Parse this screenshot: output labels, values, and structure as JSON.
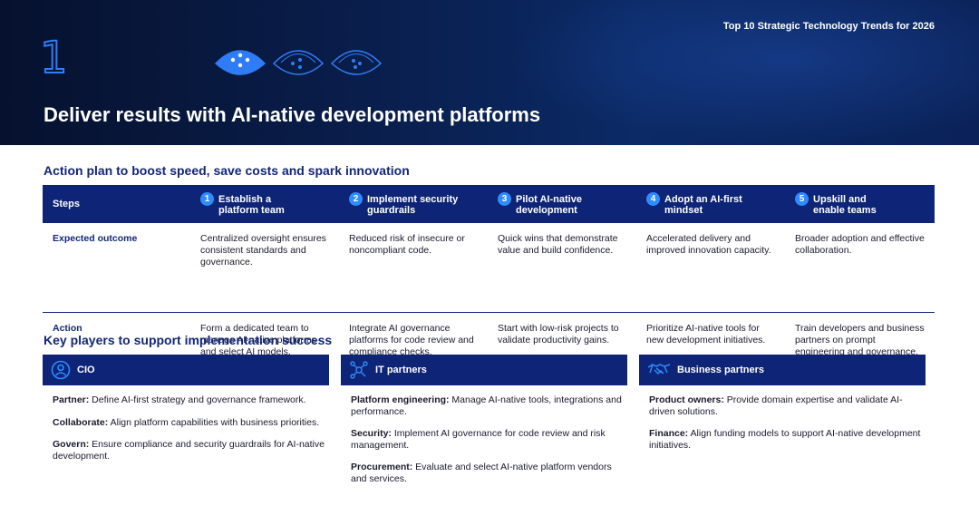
{
  "header": {
    "doc_title": "Top 10 Strategic Technology Trends for 2026",
    "trend_number": "1",
    "title": "Deliver results with AI-native development platforms",
    "icons": [
      "trend-fan-icon-active",
      "trend-fan-icon",
      "trend-fan-icon"
    ]
  },
  "action_plan": {
    "heading": "Action plan to boost speed, save costs and spark innovation",
    "steps_label": "Steps",
    "steps": [
      {
        "num": "1",
        "label": "Establish a\nplatform team"
      },
      {
        "num": "2",
        "label": "Implement security\nguardrails"
      },
      {
        "num": "3",
        "label": "Pilot AI-native\ndevelopment"
      },
      {
        "num": "4",
        "label": "Adopt an AI-first\nmindset"
      },
      {
        "num": "5",
        "label": "Upskill and\nenable teams"
      }
    ],
    "rows": [
      {
        "label": "Expected outcome",
        "cells": [
          "Centralized oversight ensures consistent standards and governance.",
          "Reduced risk of insecure or noncompliant code.",
          "Quick wins that demonstrate value and build confidence.",
          "Accelerated delivery and improved innovation capacity.",
          "Broader adoption and effective collaboration."
        ]
      },
      {
        "label": "Action",
        "cells": [
          "Form a dedicated team to manage AI-native platforms and select AI models.",
          "Integrate AI governance platforms for code review and compliance checks.",
          "Start with low-risk projects to validate productivity gains.",
          "Prioritize AI-native tools for new development initiatives.",
          "Train developers and business partners on prompt engineering and governance."
        ]
      }
    ]
  },
  "key_players": {
    "heading": "Key players to support implementation success",
    "groups": [
      {
        "name": "CIO",
        "icon": "person-circle-icon",
        "items": [
          {
            "term": "Partner:",
            "text": " Define AI-first strategy and governance framework."
          },
          {
            "term": "Collaborate:",
            "text": " Align platform capabilities with business priorities."
          },
          {
            "term": "Govern:",
            "text": " Ensure compliance and security guardrails for AI-native development."
          }
        ]
      },
      {
        "name": "IT partners",
        "icon": "network-icon",
        "items": [
          {
            "term": "Platform engineering:",
            "text": " Manage AI-native tools, integrations and performance."
          },
          {
            "term": "Security:",
            "text": " Implement AI governance for code review and risk management."
          },
          {
            "term": "Procurement:",
            "text": " Evaluate and select AI-native platform vendors and services."
          }
        ]
      },
      {
        "name": "Business partners",
        "icon": "handshake-icon",
        "items": [
          {
            "term": "Product owners:",
            "text": " Provide domain expertise and validate AI-driven solutions."
          },
          {
            "term": "Finance:",
            "text": " Align funding models to support AI-native development initiatives."
          }
        ]
      }
    ]
  },
  "colors": {
    "navy": "#0e2476",
    "heading_blue": "#12267a",
    "accent_blue": "#2f8cff",
    "banner_dark": "#06112e"
  }
}
